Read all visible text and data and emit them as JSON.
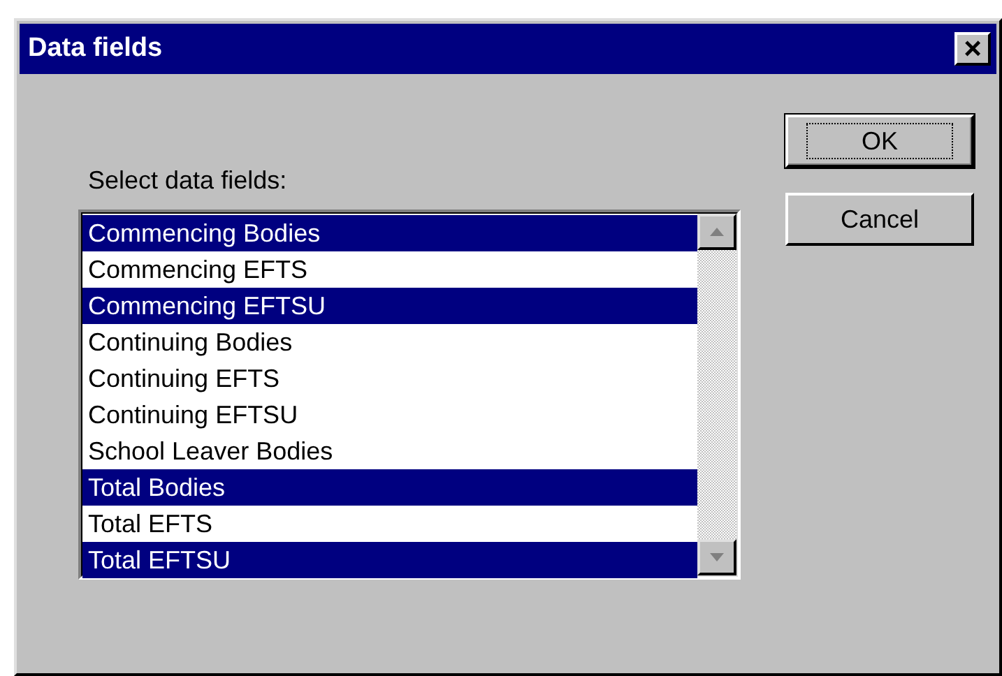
{
  "window": {
    "title": "Data fields",
    "close": "×"
  },
  "prompt": "Select data fields:",
  "fields": [
    {
      "label": "Commencing Bodies",
      "selected": true
    },
    {
      "label": "Commencing EFTS",
      "selected": false
    },
    {
      "label": "Commencing EFTSU",
      "selected": true
    },
    {
      "label": "Continuing Bodies",
      "selected": false
    },
    {
      "label": "Continuing EFTS",
      "selected": false
    },
    {
      "label": "Continuing EFTSU",
      "selected": false
    },
    {
      "label": "School Leaver Bodies",
      "selected": false
    },
    {
      "label": "Total Bodies",
      "selected": true
    },
    {
      "label": "Total EFTS",
      "selected": false
    },
    {
      "label": "Total EFTSU",
      "selected": true
    }
  ],
  "buttons": [
    {
      "label": "OK",
      "default": true
    },
    {
      "label": "Cancel",
      "default": false
    }
  ]
}
